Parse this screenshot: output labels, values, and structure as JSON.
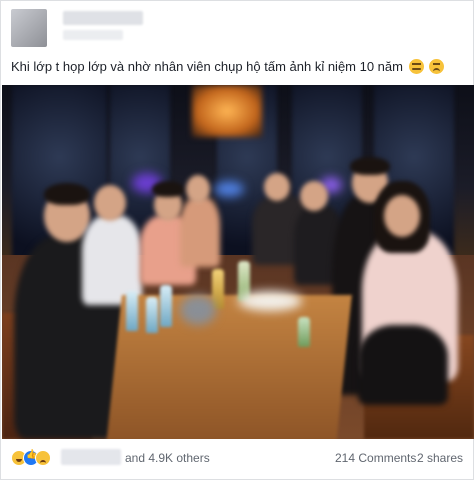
{
  "post": {
    "caption": "Khi lớp t họp lớp và nhờ nhân viên chụp hộ tấm ảnh kỉ niệm 10 năm",
    "caption_emojis": [
      "unamused-face-icon",
      "upside-down-face-icon"
    ],
    "menu_icon": "more-options-icon"
  },
  "photo": {
    "description_icon": "group-photo-image"
  },
  "footer": {
    "reaction_icons": [
      "haha-reaction-icon",
      "like-reaction-icon",
      "sad-reaction-icon"
    ],
    "others_label": "and 4.9K others",
    "comments_label": "214 Comments",
    "shares_label": "2 shares"
  },
  "colors": {
    "text": "#1d2129",
    "muted": "#616770",
    "like_blue": "#2078f4",
    "emoji_yellow": "#f7c23a"
  }
}
